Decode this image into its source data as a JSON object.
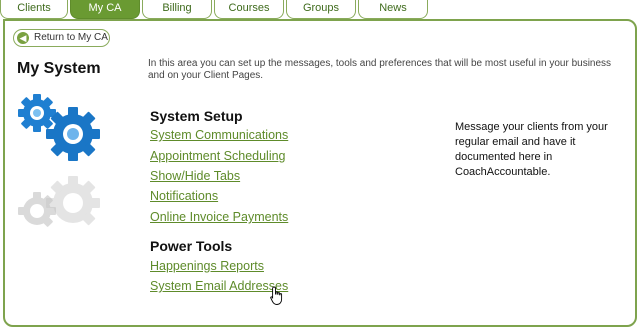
{
  "tabs": [
    {
      "label": "Clients",
      "active": false
    },
    {
      "label": "My CA",
      "active": true
    },
    {
      "label": "Billing",
      "active": false
    },
    {
      "label": "Courses",
      "active": false
    },
    {
      "label": "Groups",
      "active": false
    },
    {
      "label": "News",
      "active": false
    }
  ],
  "return_button": {
    "label": "Return to My CA",
    "icon": "left-arrow-icon"
  },
  "page_title": "My System",
  "intro_text": "In this area you can set up the messages, tools and preferences that will be most useful in your business and on your Client Pages.",
  "system_setup": {
    "heading": "System Setup",
    "links": [
      "System Communications",
      "Appointment Scheduling",
      "Show/Hide Tabs",
      "Notifications",
      "Online Invoice Payments"
    ]
  },
  "power_tools": {
    "heading": "Power Tools",
    "links": [
      "Happenings Reports",
      "System Email Addresses"
    ]
  },
  "description": "Message your clients from your regular email and have it documented here in CoachAccountable.",
  "colors": {
    "accent_green": "#6a9a32",
    "link_green": "#5e8b2a",
    "gear_blue": "#1f7fd1",
    "gear_grey": "#c9c9c9"
  },
  "icons": [
    "gears-icon",
    "hand-cursor-icon"
  ]
}
